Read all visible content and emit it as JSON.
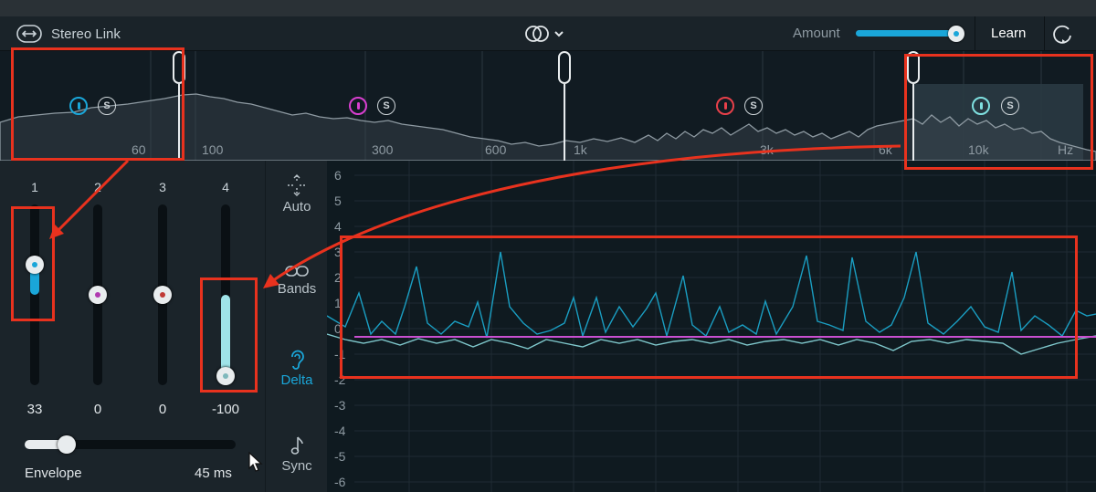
{
  "toolbar": {
    "stereo_link_label": "Stereo Link",
    "amount_label": "Amount",
    "amount_value": 0.93,
    "learn_label": "Learn"
  },
  "spectrum": {
    "freq_labels": [
      "60",
      "100",
      "300",
      "600",
      "1k",
      "3k",
      "6k",
      "10k",
      "Hz"
    ],
    "bands": [
      {
        "id": 1,
        "color": "#1aa6d9"
      },
      {
        "id": 2,
        "color": "#d93fd0"
      },
      {
        "id": 3,
        "color": "#e8404a"
      },
      {
        "id": 4,
        "color": "#7fe0e0"
      }
    ],
    "solo_label": "S"
  },
  "band_sliders": [
    {
      "number": "1",
      "value": "33",
      "color": "#1aa6d9",
      "dot": "#1aa6d9",
      "level": 0.33
    },
    {
      "number": "2",
      "value": "0",
      "color": "#d93fd0",
      "dot": "#b03ab0",
      "level": 0.0
    },
    {
      "number": "3",
      "value": "0",
      "color": "#e8404a",
      "dot": "#c03a36",
      "level": 0.0
    },
    {
      "number": "4",
      "value": "-100",
      "color": "#9fe3e8",
      "dot": "#7fb8bc",
      "level": -1.0
    }
  ],
  "envelope": {
    "label": "Envelope",
    "value": "45 ms",
    "level": 0.2
  },
  "modes": [
    {
      "label": "Auto",
      "icon": "crosshair-arrows-icon"
    },
    {
      "label": "Bands",
      "icon": "link-icon"
    },
    {
      "label": "Delta",
      "icon": "ear-icon",
      "active": true
    },
    {
      "label": "Sync",
      "icon": "music-note-icon"
    }
  ],
  "plot": {
    "y_labels": [
      "6",
      "5",
      "4",
      "3",
      "2",
      "1",
      "0",
      "-1",
      "-2",
      "-3",
      "-4",
      "-5",
      "-6"
    ]
  }
}
